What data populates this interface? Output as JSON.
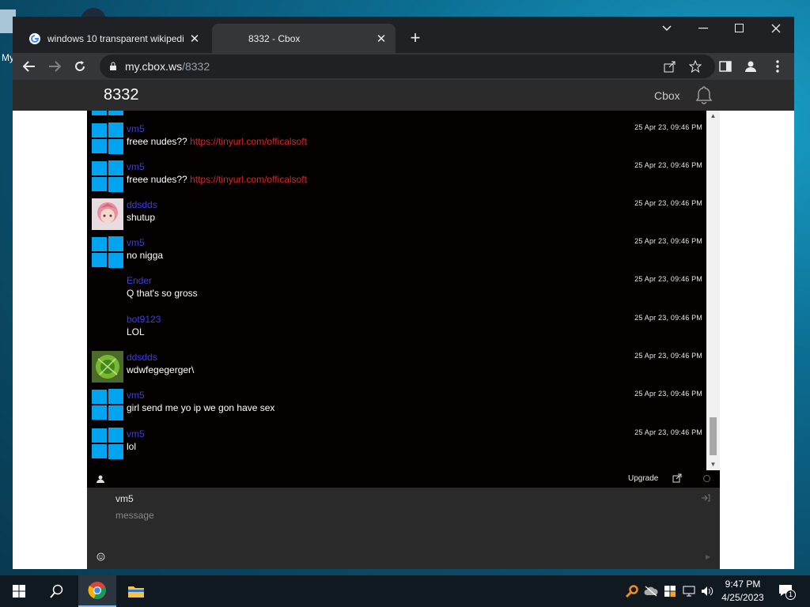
{
  "desktop": {
    "icon_label": "My"
  },
  "browser": {
    "tabs": [
      {
        "title": "windows 10 transparent wikipedi",
        "close": "✕",
        "active": false
      },
      {
        "title": "8332 - Cbox",
        "close": "✕",
        "active": true
      }
    ],
    "new_tab": "+",
    "window_controls": {
      "dropdown": "⌄",
      "minimize": "—",
      "maximize": "☐",
      "close": "✕"
    },
    "url": {
      "host": "my.cbox.ws",
      "path": "/8332"
    }
  },
  "site": {
    "title": "8332",
    "brand": "Cbox"
  },
  "messages": [
    {
      "user": "vm5",
      "avatar": "windows-logo",
      "time": "25 Apr 23, 09:46 PM",
      "text": "freee nudes?? ",
      "link": "https://tinyurl.com/officalsoft"
    },
    {
      "user": "vm5",
      "avatar": "windows-logo",
      "time": "25 Apr 23, 09:46 PM",
      "text": "freee nudes?? ",
      "link": "https://tinyurl.com/officalsoft"
    },
    {
      "user": "ddsdds",
      "avatar": "anime-avatar",
      "time": "25 Apr 23, 09:46 PM",
      "text": "shutup",
      "link": ""
    },
    {
      "user": "vm5",
      "avatar": "windows-logo",
      "time": "25 Apr 23, 09:46 PM",
      "text": "no nigga",
      "link": ""
    },
    {
      "user": "Ender",
      "avatar": "none",
      "time": "25 Apr 23, 09:46 PM",
      "text": "Q that's so gross",
      "link": ""
    },
    {
      "user": "bot9123",
      "avatar": "none",
      "time": "25 Apr 23, 09:46 PM",
      "text": "LOL",
      "link": ""
    },
    {
      "user": "ddsdds",
      "avatar": "green-avatar",
      "time": "25 Apr 23, 09:46 PM",
      "text": "wdwfegegerger\\",
      "link": ""
    },
    {
      "user": "vm5",
      "avatar": "windows-logo",
      "time": "25 Apr 23, 09:46 PM",
      "text": "girl send me yo ip we gon have sex",
      "link": ""
    },
    {
      "user": "vm5",
      "avatar": "windows-logo",
      "time": "25 Apr 23, 09:46 PM",
      "text": "lol",
      "link": ""
    }
  ],
  "chat_footer": {
    "upgrade": "Upgrade"
  },
  "compose": {
    "name": "vm5",
    "placeholder": "message"
  },
  "taskbar": {
    "time": "9:47 PM",
    "date": "4/25/2023",
    "notifications": "1"
  },
  "colors": {
    "username": "#3a3af0",
    "link": "#e02020",
    "chat_bg": "#050000",
    "windows_blue": "#00a4ef"
  }
}
